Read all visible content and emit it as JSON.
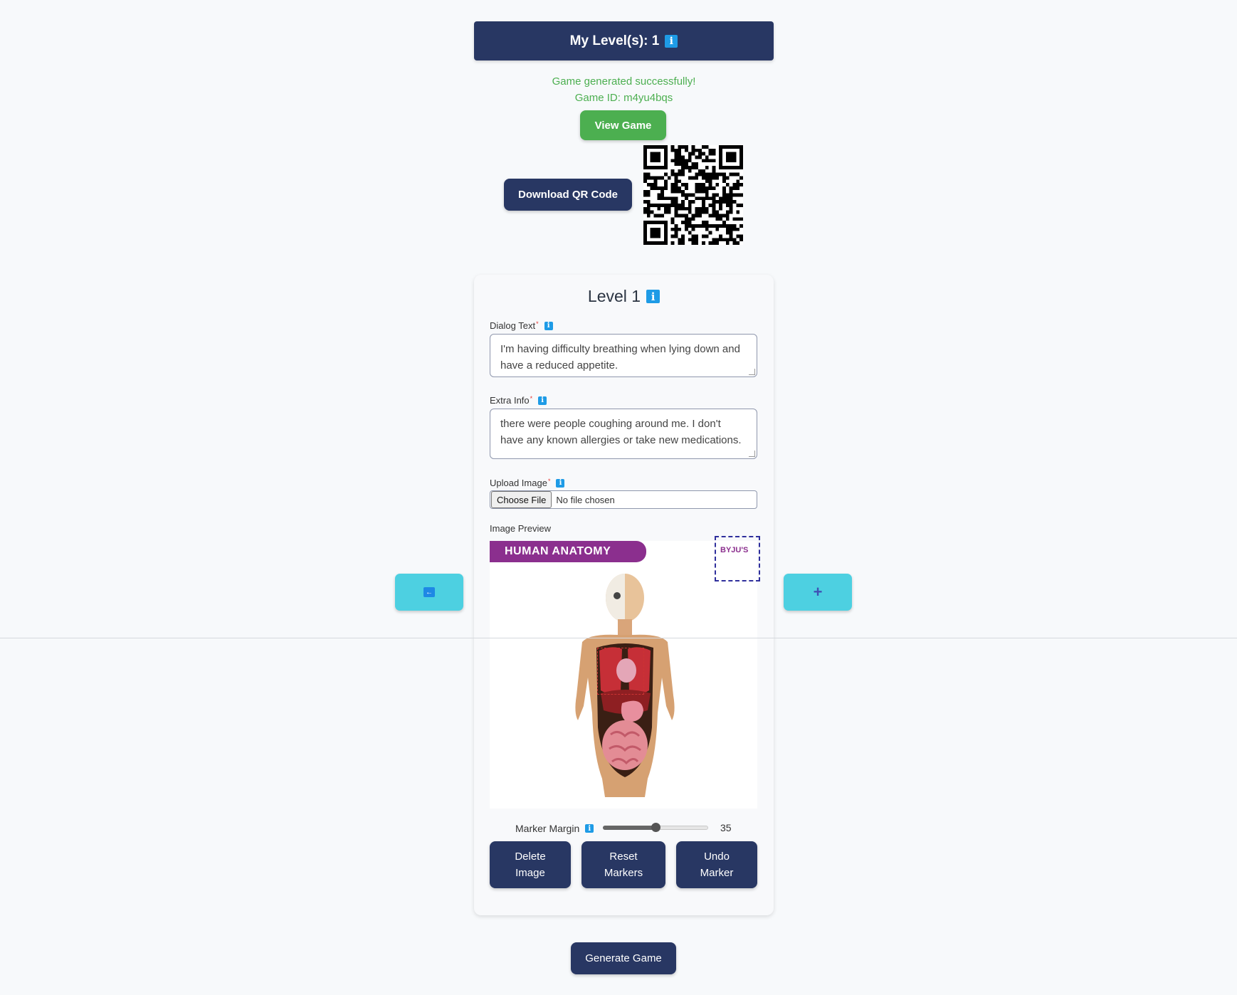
{
  "header": {
    "levels_label": "My Level(s): 1",
    "info_glyph": "i"
  },
  "status": {
    "success": "Game generated successfully!",
    "game_id": "Game ID: m4yu4bqs"
  },
  "buttons": {
    "view_game": "View Game",
    "download_qr": "Download QR Code",
    "add_level": "+",
    "delete_image": "Delete Image",
    "reset_markers": "Reset Markers",
    "undo_marker": "Undo Marker",
    "generate_game": "Generate Game"
  },
  "level": {
    "title": "Level 1",
    "dialog_label": "Dialog Text",
    "dialog_value": "I'm having difficulty breathing when lying down and have a reduced appetite.",
    "extra_label": "Extra Info",
    "extra_value": "there were people coughing around me. I don't have any known allergies or take new medications.",
    "upload_label": "Upload Image",
    "choose_file": "Choose File",
    "file_status": "No file chosen",
    "preview_label": "Image Preview",
    "preview_banner": "HUMAN ANATOMY",
    "logo_text": "BYJU'S",
    "marker_margin_label": "Marker Margin",
    "marker_margin_value": "35",
    "marker_margin_fraction": 0.5
  },
  "colors": {
    "navy": "#283763",
    "green": "#4caf50",
    "cyan": "#4dd0e1",
    "info": "#1e9be6"
  }
}
